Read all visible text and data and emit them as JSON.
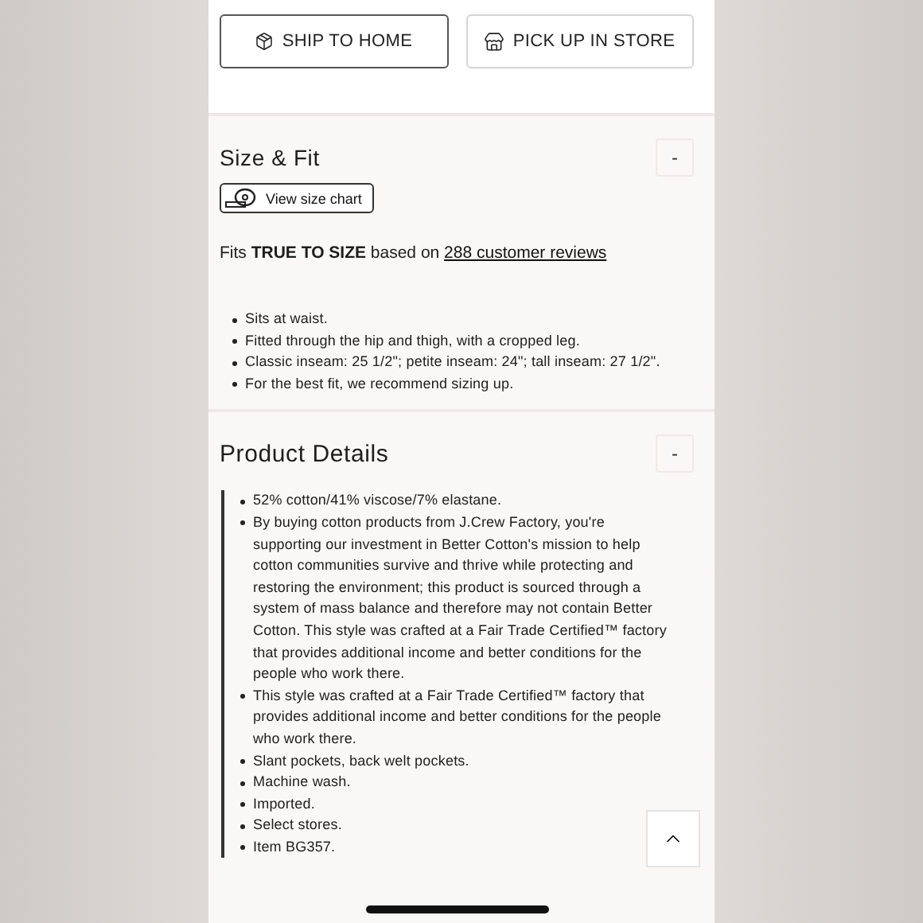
{
  "delivery_options": [
    {
      "kind": "ship",
      "label": "SHIP TO HOME",
      "selected": true
    },
    {
      "kind": "store",
      "label": "PICK UP IN STORE",
      "selected": false
    }
  ],
  "size_fit": {
    "title": "Size & Fit",
    "toggle": "-",
    "expanded": true,
    "size_chart_link": "View size chart",
    "fit_note": {
      "text": "Fits **TRUE TO SIZE** based on",
      "link": "288 customer reviews"
    },
    "bullets": [
      "Sits at waist.",
      "Fitted through the hip and thigh, with a cropped leg.",
      "Classic inseam: 25 1/2\"; petite inseam: 24\"; tall inseam: 27 1/2\".",
      "For the best fit, we recommend sizing up."
    ]
  },
  "product_details": {
    "title": "Product Details",
    "toggle": "-",
    "expanded": true,
    "bullets": [
      "52% cotton/41% viscose/7% elastane.",
      "By buying cotton products from J.Crew Factory, you're supporting our investment in Better Cotton's mission to help cotton communities survive and thrive while protecting and restoring the environment; this product is sourced through a system of mass balance and therefore may not contain Better Cotton. This style was crafted at a Fair Trade Certified™ factory that provides additional income and better conditions for the people who work there.",
      "This style was crafted at a Fair Trade Certified™ factory that provides additional income and better conditions for the people who work there.",
      "Slant pockets, back welt pockets.",
      "Machine wash.",
      "Imported.",
      "Select stores.",
      "Item BG357."
    ]
  }
}
